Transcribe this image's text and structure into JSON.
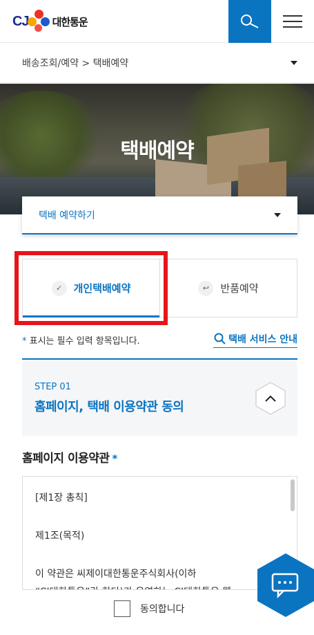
{
  "header": {
    "logo_cj": "CJ",
    "logo_text": "대한통운"
  },
  "breadcrumb": {
    "text": "배송조회/예약 > 택배예약"
  },
  "hero": {
    "title": "택배예약"
  },
  "dropdown": {
    "selected": "택배 예약하기"
  },
  "tabs": [
    {
      "label": "개인택배예약",
      "icon": "check-icon",
      "active": true
    },
    {
      "label": "반품예약",
      "icon": "return-arrow-icon",
      "active": false
    }
  ],
  "required_note": {
    "star": "*",
    "text": "표시는 필수 입력 항목입니다."
  },
  "service_guide": {
    "label": "택배 서비스 안내"
  },
  "step": {
    "number": "STEP 01",
    "title": "홈페이지, 택배 이용약관 동의"
  },
  "terms": {
    "title": "홈페이지 이용약관",
    "star": "*",
    "lines": [
      "[제1장 총칙]",
      "제1조(목적)",
      "이 약관은 씨제이대한통운주식회사(이하",
      "“CJ대한통운”라 한다)가 운영하는 CJ대한통운 웹"
    ]
  },
  "agree": {
    "label": "동의합니다"
  },
  "colors": {
    "accent": "#0b74c1",
    "highlight": "#e8141b"
  }
}
